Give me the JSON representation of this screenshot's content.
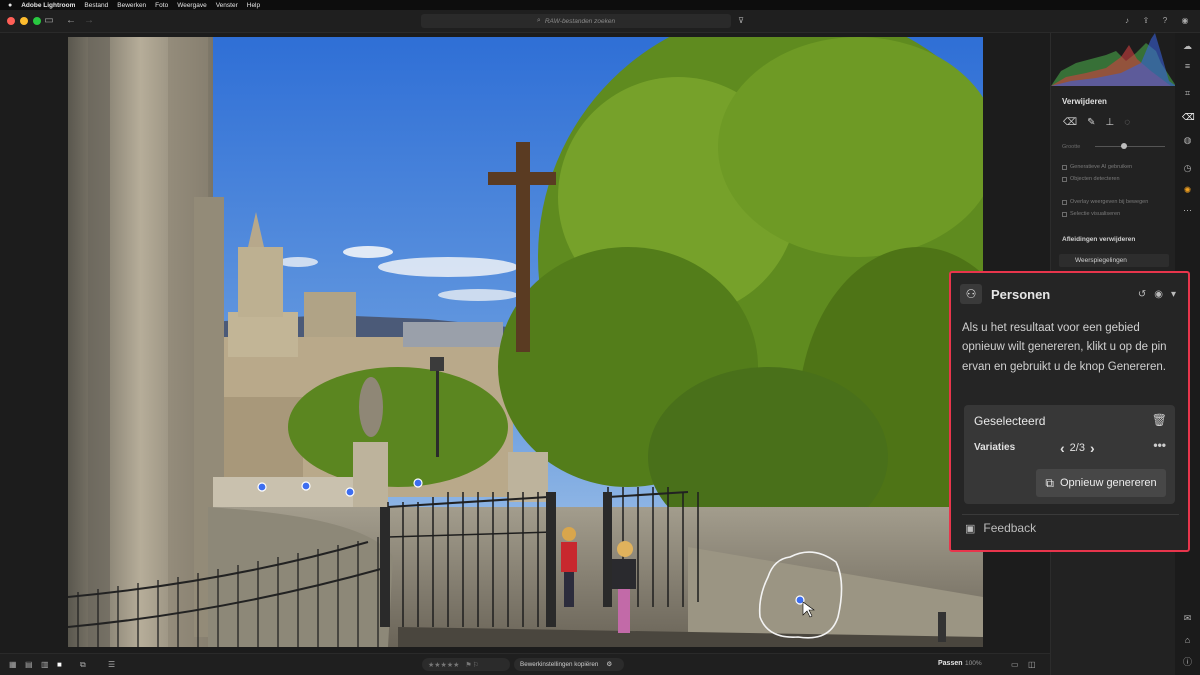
{
  "menubar": {
    "apple": "",
    "items": [
      "Adobe Lightroom",
      "Bestand",
      "Bewerken",
      "Foto",
      "Weergave",
      "Venster",
      "Help"
    ]
  },
  "window": {
    "traffic_colors": [
      "#ff5f57",
      "#febc2e",
      "#28c840"
    ]
  },
  "search": {
    "placeholder": "RAW-bestanden zoeken"
  },
  "right_panel": {
    "title": "Verwijderen",
    "size_label": "Grootte",
    "check1": "Generatieve AI gebruiken",
    "check2": "Objecten detecteren",
    "check3": "Overlay weergeven bij bewegen",
    "check4": "Selectie visualiseren",
    "section": "Afleidingen verwijderen",
    "reflections": "Weerspiegelingen"
  },
  "personen": {
    "title": "Personen",
    "description": "Als u het resultaat voor een gebied opnieuw wilt genereren, klikt u op de pin ervan en gebruikt u de knop Genereren.",
    "card_title": "Geselecteerd",
    "variations_label": "Variaties",
    "variation_counter": "2/3",
    "regenerate_label": "Opnieuw genereren",
    "feedback_label": "Feedback",
    "accent_color": "#e8354c"
  },
  "bottombar": {
    "stars": "★★★★★",
    "copy_settings": "Bewerkinstellingen kopiëren",
    "fit_label": "Passen",
    "zoom_value": "100%"
  },
  "photo": {
    "pin_color": "#3d6ef0"
  }
}
